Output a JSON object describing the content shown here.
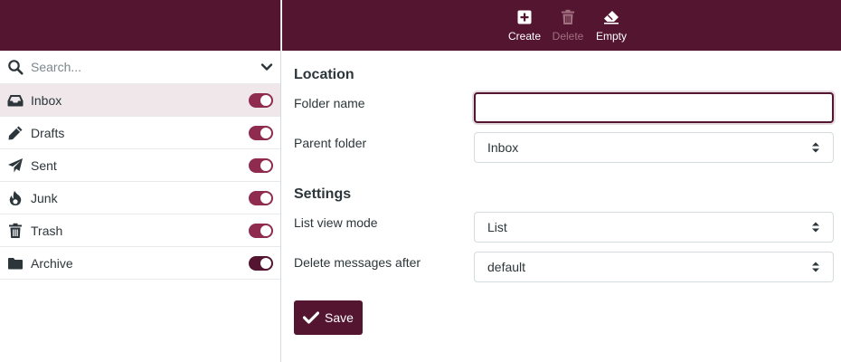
{
  "search": {
    "placeholder": "Search..."
  },
  "folders": [
    {
      "label": "Inbox",
      "icon": "inbox-icon",
      "selected": true
    },
    {
      "label": "Drafts",
      "icon": "pencil-icon"
    },
    {
      "label": "Sent",
      "icon": "paper-plane-icon"
    },
    {
      "label": "Junk",
      "icon": "fire-icon"
    },
    {
      "label": "Trash",
      "icon": "trash-icon"
    },
    {
      "label": "Archive",
      "icon": "folder-icon"
    }
  ],
  "toolbar": {
    "create_label": "Create",
    "delete_label": "Delete",
    "empty_label": "Empty"
  },
  "form": {
    "location_title": "Location",
    "folder_name_label": "Folder name",
    "folder_name_value": "",
    "parent_folder_label": "Parent folder",
    "parent_folder_value": "Inbox",
    "settings_title": "Settings",
    "list_view_mode_label": "List view mode",
    "list_view_mode_value": "List",
    "delete_after_label": "Delete messages after",
    "delete_after_value": "default",
    "save_label": "Save"
  },
  "colors": {
    "brand": "#541531",
    "toggle_on": "#8f2b4e",
    "selected_row": "#efe7ea"
  }
}
